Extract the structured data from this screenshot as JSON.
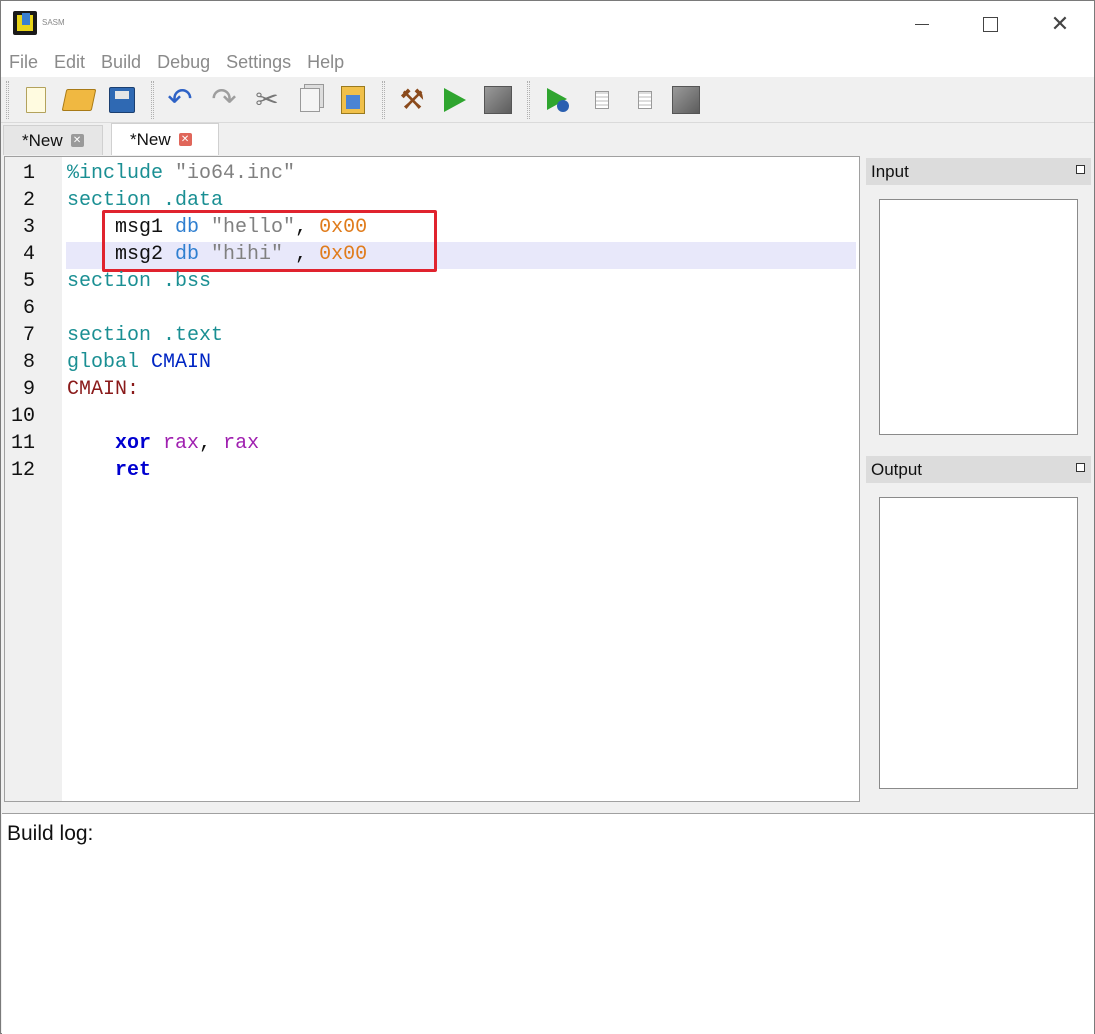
{
  "window": {
    "title": "SASM"
  },
  "menu": {
    "items": [
      "File",
      "Edit",
      "Build",
      "Debug",
      "Settings",
      "Help"
    ]
  },
  "toolbar": {
    "buttons": [
      "new-file",
      "open-file",
      "save-file",
      "undo",
      "redo",
      "cut",
      "copy",
      "paste",
      "build",
      "run",
      "stop",
      "debug",
      "step-over",
      "step-into",
      "stop-debug"
    ]
  },
  "tabs": [
    {
      "label": "*New",
      "active": false
    },
    {
      "label": "*New",
      "active": true
    }
  ],
  "editor": {
    "line_numbers": [
      "1",
      "2",
      "3",
      "4",
      "5",
      "6",
      "7",
      "8",
      "9",
      "10",
      "11",
      "12"
    ],
    "current_line": 4,
    "lines": [
      [
        {
          "t": "%include ",
          "c": "dir"
        },
        {
          "t": "\"io64.inc\"",
          "c": "str"
        }
      ],
      [
        {
          "t": "section .data",
          "c": "dir"
        }
      ],
      [
        {
          "t": "    msg1 ",
          "c": "plain"
        },
        {
          "t": "db ",
          "c": "kw"
        },
        {
          "t": "\"hello\"",
          "c": "str"
        },
        {
          "t": ", ",
          "c": "plain"
        },
        {
          "t": "0x00",
          "c": "num"
        }
      ],
      [
        {
          "t": "    msg2 ",
          "c": "plain"
        },
        {
          "t": "db ",
          "c": "kw"
        },
        {
          "t": "\"hihi\"",
          "c": "str"
        },
        {
          "t": " , ",
          "c": "plain"
        },
        {
          "t": "0x00",
          "c": "num"
        }
      ],
      [
        {
          "t": "section .bss",
          "c": "dir"
        }
      ],
      [],
      [
        {
          "t": "section .text",
          "c": "dir"
        }
      ],
      [
        {
          "t": "global ",
          "c": "dir"
        },
        {
          "t": "CMAIN",
          "c": "glob"
        }
      ],
      [
        {
          "t": "CMAIN:",
          "c": "label"
        }
      ],
      [],
      [
        {
          "t": "    ",
          "c": "plain"
        },
        {
          "t": "xor",
          "c": "op"
        },
        {
          "t": " ",
          "c": "plain"
        },
        {
          "t": "rax",
          "c": "reg"
        },
        {
          "t": ", ",
          "c": "plain"
        },
        {
          "t": "rax",
          "c": "reg"
        }
      ],
      [
        {
          "t": "    ",
          "c": "plain"
        },
        {
          "t": "ret",
          "c": "op"
        }
      ]
    ]
  },
  "panels": {
    "input_title": "Input",
    "output_title": "Output"
  },
  "build_log": {
    "label": "Build log:"
  },
  "colors": {
    "directive": "#1a8f93",
    "string": "#808080",
    "keyword": "#2f7fd0",
    "number": "#e07c1c",
    "label": "#8a1a1a",
    "highlight_box": "#e0232e",
    "current_line": "#e8e8fa"
  }
}
